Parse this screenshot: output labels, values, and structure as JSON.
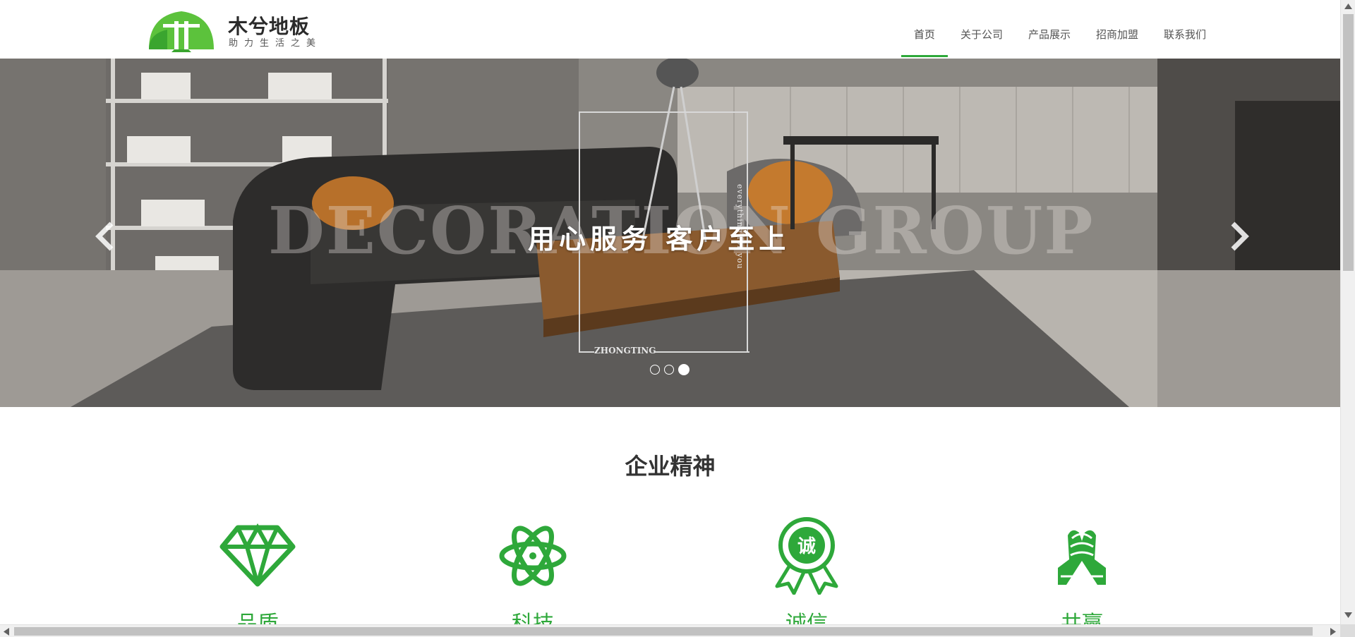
{
  "header": {
    "logo_title": "木兮地板",
    "logo_slogan": "助力生活之美",
    "nav": [
      {
        "label": "首页",
        "active": true
      },
      {
        "label": "关于公司",
        "active": false
      },
      {
        "label": "产品展示",
        "active": false
      },
      {
        "label": "招商加盟",
        "active": false
      },
      {
        "label": "联系我们",
        "active": false
      }
    ]
  },
  "banner": {
    "background_word": "DECORATION GROUP",
    "slogan": "用心服务  客户至上",
    "vertical_text": "everything for you",
    "sub_text": "ZHONGTING",
    "slides": 3,
    "active_slide": 3,
    "prev_icon": "chevron-left-icon",
    "next_icon": "chevron-right-icon"
  },
  "section": {
    "title": "企业精神",
    "features": [
      {
        "label": "品质",
        "icon": "diamond-icon"
      },
      {
        "label": "科技",
        "icon": "atom-icon"
      },
      {
        "label": "诚信",
        "icon": "badge-icon",
        "badge_text": "诚"
      },
      {
        "label": "共赢",
        "icon": "handshake-icon"
      }
    ]
  },
  "colors": {
    "accent": "#2ea83a",
    "text": "#333333"
  }
}
